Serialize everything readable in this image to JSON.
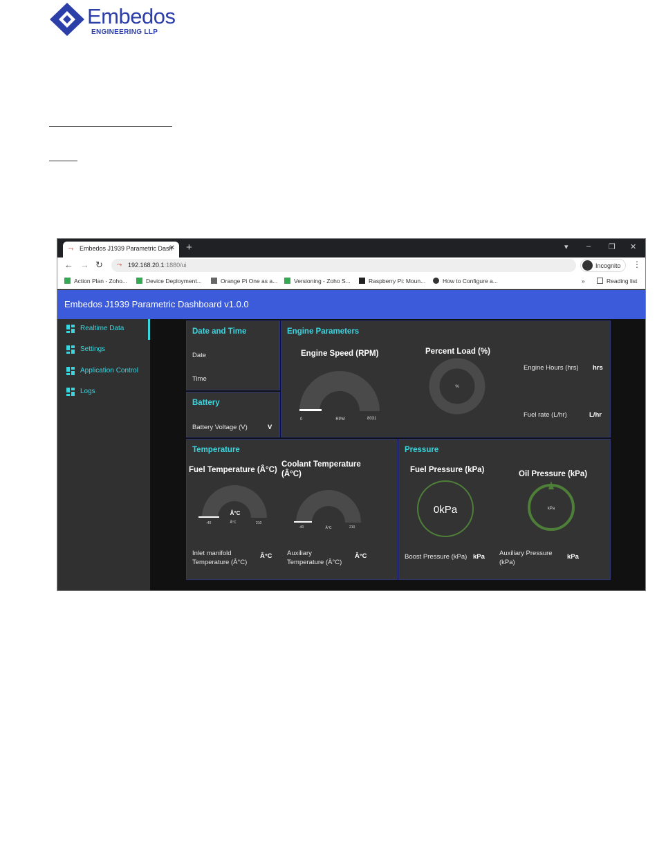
{
  "logo": {
    "name": "Embedos",
    "subtitle": "ENGINEERING LLP"
  },
  "browser": {
    "tab_title": "Embedos J1939 Parametric Dash",
    "url_host": "192.168.20.1",
    "url_path": ":1880/ui",
    "incognito_label": "Incognito",
    "bookmarks": [
      "Action Plan - Zoho...",
      "Device Deployment...",
      "Orange Pi One as a...",
      "Versioning - Zoho S...",
      "Raspberry Pi: Moun...",
      "How to Configure a..."
    ],
    "overflow_label": "»",
    "reading_list_label": "Reading list"
  },
  "app": {
    "title": "Embedos J1939 Parametric Dashboard v1.0.0",
    "accent_color": "#3ad6e0",
    "header_color": "#3b5bdb"
  },
  "sidebar": {
    "items": [
      {
        "label": "Realtime Data",
        "icon": "dashboard-icon",
        "active": true
      },
      {
        "label": "Settings",
        "icon": "dashboard-icon",
        "active": false
      },
      {
        "label": "Application Control",
        "icon": "dashboard-icon",
        "active": false
      },
      {
        "label": "Logs",
        "icon": "dashboard-icon",
        "active": false
      }
    ]
  },
  "date_time": {
    "title": "Date and Time",
    "date_label": "Date",
    "time_label": "Time"
  },
  "battery": {
    "title": "Battery",
    "voltage_label": "Battery Voltage (V)",
    "voltage_unit": "V"
  },
  "engine": {
    "title": "Engine Parameters",
    "speed_title": "Engine Speed (RPM)",
    "speed_min": "0",
    "speed_max": "8031",
    "speed_unit": "RPM",
    "load_title": "Percent Load (%)",
    "load_unit": "%",
    "hours_label": "Engine Hours (hrs)",
    "hours_unit": "hrs",
    "fuel_rate_label": "Fuel rate (L/hr)",
    "fuel_rate_unit": "L/hr"
  },
  "temperature": {
    "title": "Temperature",
    "fuel_title": "Fuel Temperature (Â°C)",
    "fuel_value": "Â°C",
    "fuel_unit": "Â°C",
    "fuel_min": "-40",
    "fuel_max": "210",
    "coolant_title": "Coolant Temperature (Â°C)",
    "coolant_unit": "Â°C",
    "coolant_min": "-40",
    "coolant_max": "210",
    "inlet_label": "Inlet manifold Temperature (Â°C)",
    "inlet_unit": "Â°C",
    "aux_label": "Auxiliary Temperature (Â°C)",
    "aux_unit": "Â°C"
  },
  "pressure": {
    "title": "Pressure",
    "fuel_title": "Fuel Pressure (kPa)",
    "fuel_value": "0kPa",
    "oil_title": "Oil Pressure (kPa)",
    "oil_unit": "kPa",
    "boost_label": "Boost Pressure (kPa)",
    "boost_unit": "kPa",
    "aux_label": "Auxiliary Pressure (kPa)",
    "aux_unit": "kPa"
  }
}
